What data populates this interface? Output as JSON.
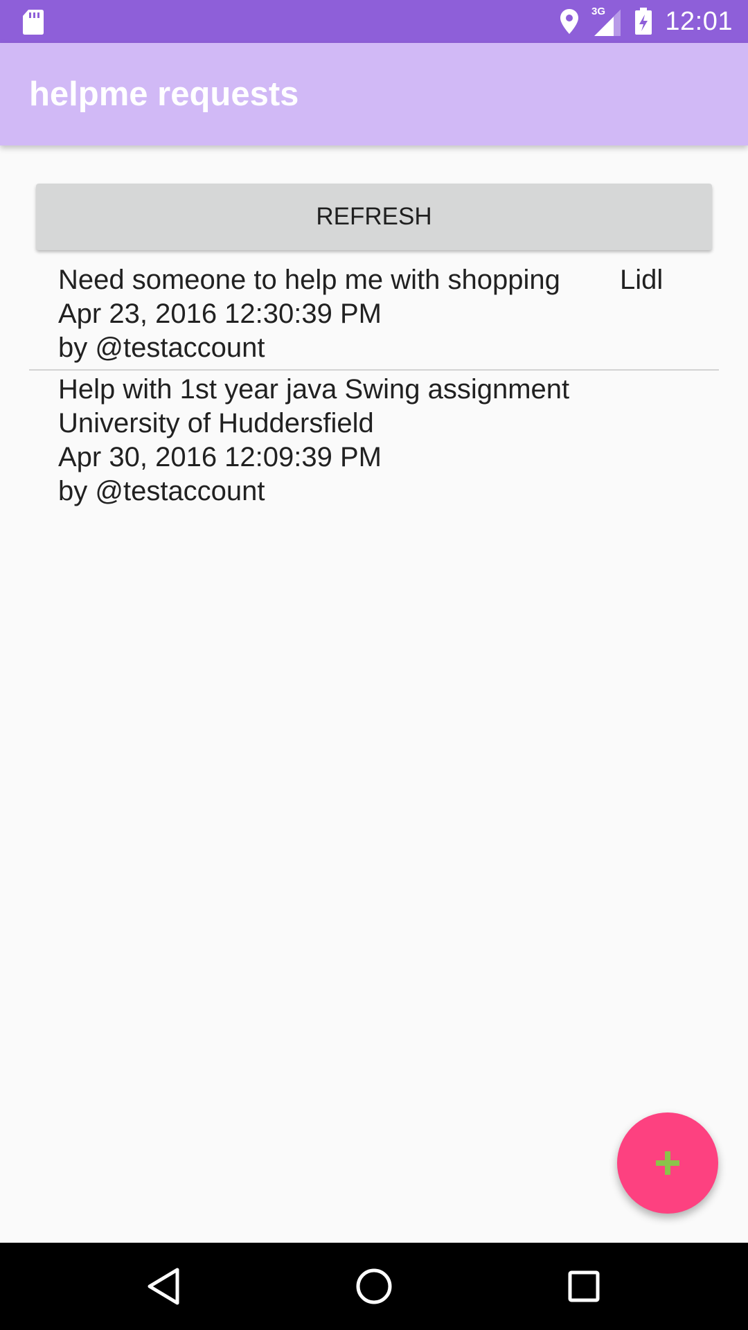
{
  "status_bar": {
    "time": "12:01",
    "network_label": "3G",
    "icons": [
      "sd-card-icon",
      "location-pin-icon",
      "signal-icon",
      "battery-charging-icon"
    ]
  },
  "app_bar": {
    "title": "helpme requests"
  },
  "refresh_button": {
    "label": "REFRESH"
  },
  "requests": [
    {
      "title": "Need someone to help me with shopping",
      "location": "Lidl",
      "date": "Apr 23, 2016 12:30:39 PM",
      "author": "by @testaccount"
    },
    {
      "title": "Help with 1st year java Swing assignment",
      "location": "University of Huddersfield",
      "date": "Apr 30, 2016 12:09:39 PM",
      "author": "by @testaccount"
    }
  ],
  "fab": {
    "icon": "plus-icon"
  },
  "nav_bar": {
    "icons": [
      "back-icon",
      "home-icon",
      "recents-icon"
    ]
  },
  "colors": {
    "status_bar": "#8e5fd9",
    "app_bar": "#d1b9f6",
    "fab": "#fd4180",
    "fab_icon": "#8bc34a",
    "refresh_button": "#d6d7d7"
  }
}
